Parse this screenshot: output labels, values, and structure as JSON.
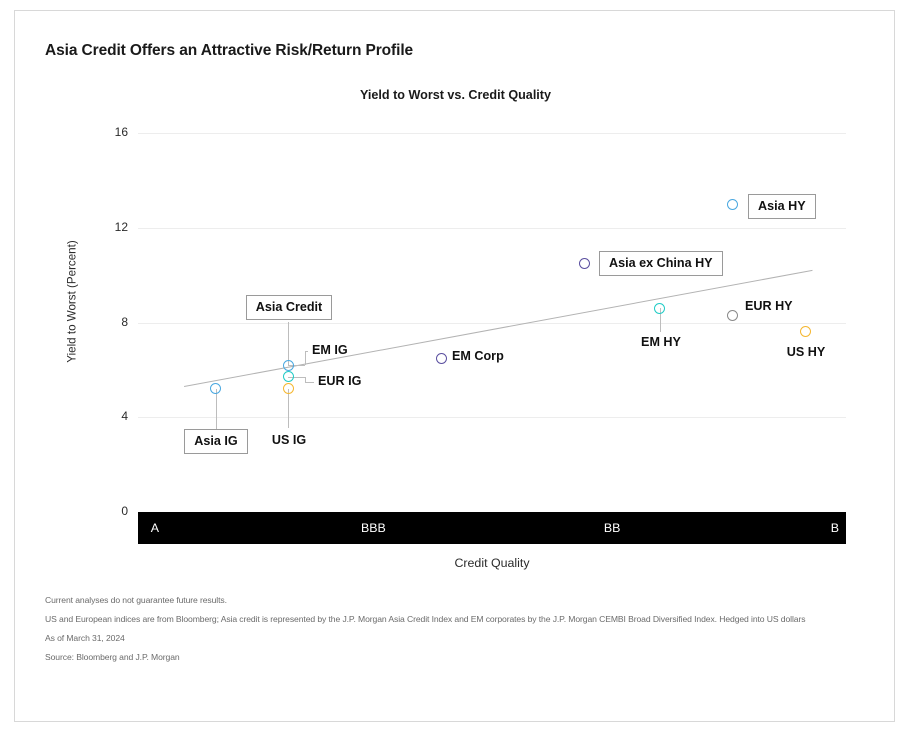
{
  "header": {
    "title": "Asia Credit Offers an Attractive Risk/Return Profile"
  },
  "colors": {
    "blue": "#4AA8E0",
    "teal": "#22CCC6",
    "orange": "#F5B731",
    "purple": "#5B50A0",
    "gray": "#8A8A8A",
    "gridline": "#EDEDED",
    "trendline": "#B3B3B3",
    "axis_band": "#000000",
    "box_border": "#9A9A9A"
  },
  "chart_data": {
    "type": "scatter",
    "title": "Yield to Worst vs. Credit Quality",
    "xlabel": "Credit Quality",
    "ylabel": "Yield to Worst (Percent)",
    "ylim": [
      0,
      16
    ],
    "yticks": [
      "0",
      "4",
      "8",
      "12",
      "16"
    ],
    "ytick_values": [
      0,
      4,
      8,
      12,
      16
    ],
    "xticks": [
      "A",
      "BBB",
      "BB",
      "B"
    ],
    "grid": true,
    "legend": "none",
    "trendline": {
      "label": "linear fit",
      "x_start": 0.065,
      "y_start": 5.3,
      "x_end": 0.952,
      "y_end": 10.2
    },
    "points": [
      {
        "name": "Asia IG",
        "label": "Asia IG",
        "x_frac": 0.11,
        "yield": 5.2,
        "color": "#4AA8E0",
        "boxed": true,
        "label_pos": "below"
      },
      {
        "name": "EM IG",
        "label": "EM IG",
        "x_frac": 0.212,
        "yield": 6.2,
        "color": "#4AA8E0",
        "boxed": false,
        "label_pos": "right"
      },
      {
        "name": "EUR IG",
        "label": "EUR IG",
        "x_frac": 0.212,
        "yield": 5.7,
        "color": "#22CCC6",
        "boxed": false,
        "label_pos": "right"
      },
      {
        "name": "US IG",
        "label": "US IG",
        "x_frac": 0.212,
        "yield": 5.2,
        "color": "#F5B731",
        "boxed": false,
        "label_pos": "below"
      },
      {
        "name": "Asia Credit",
        "label": "Asia Credit",
        "x_frac": 0.212,
        "yield": 6.2,
        "color": "#4AA8E0",
        "boxed": true,
        "label_pos": "above"
      },
      {
        "name": "EM Corp",
        "label": "EM Corp",
        "x_frac": 0.428,
        "yield": 6.5,
        "color": "#5B50A0",
        "boxed": false,
        "label_pos": "right"
      },
      {
        "name": "Asia ex China HY",
        "label": "Asia ex China HY",
        "x_frac": 0.63,
        "yield": 10.5,
        "color": "#5B50A0",
        "boxed": true,
        "label_pos": "right"
      },
      {
        "name": "EM HY",
        "label": "EM HY",
        "x_frac": 0.737,
        "yield": 8.6,
        "color": "#22CCC6",
        "boxed": false,
        "label_pos": "below"
      },
      {
        "name": "EUR HY",
        "label": "EUR HY",
        "x_frac": 0.84,
        "yield": 8.3,
        "color": "#8A8A8A",
        "boxed": false,
        "label_pos": "right"
      },
      {
        "name": "Asia HY",
        "label": "Asia HY",
        "x_frac": 0.84,
        "yield": 13.0,
        "color": "#4AA8E0",
        "boxed": true,
        "label_pos": "right"
      },
      {
        "name": "US HY",
        "label": "US HY",
        "x_frac": 0.943,
        "yield": 7.6,
        "color": "#F5B731",
        "boxed": false,
        "label_pos": "below"
      }
    ]
  },
  "footnotes": [
    "Current analyses do not guarantee future results.",
    "US and European indices are from Bloomberg; Asia credit is represented by the J.P. Morgan Asia Credit Index and EM corporates by the J.P. Morgan CEMBI Broad Diversified Index. Hedged into US dollars",
    "As of March 31, 2024",
    "Source: Bloomberg and J.P. Morgan"
  ]
}
